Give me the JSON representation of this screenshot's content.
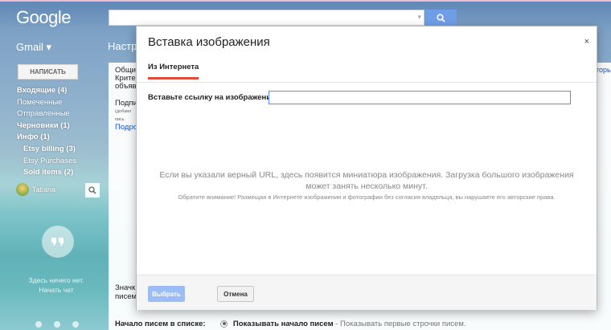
{
  "brand": {
    "logo": "Google"
  },
  "header": {
    "app_label": "Gmail ▾",
    "page_title_partial": "Настр"
  },
  "compose": {
    "label": "НАПИСАТЬ"
  },
  "sidebar": {
    "items": [
      {
        "label": "Входящие (4)"
      },
      {
        "label": "Помеченные"
      },
      {
        "label": "Отправленные"
      },
      {
        "label": "Черновики (1)"
      },
      {
        "label": "Инфо (1)"
      },
      {
        "label": "Etsy billing (3)"
      },
      {
        "label": "Etsy Purchases"
      },
      {
        "label": "Sold items (2)"
      }
    ],
    "user_name": "Tatiana"
  },
  "hangouts": {
    "line1": "Здесь ничего нет.",
    "line2": "Начать чат"
  },
  "settings": {
    "tab_partial": "Общие",
    "crit_partial1": "Критер",
    "crit_partial2": "объяв",
    "sig_partial": "Подпи",
    "sig_small1": "(добавл",
    "sig_small2": "пись",
    "sig_link": "Подроб",
    "start_partial1": "Значк",
    "start_partial2": "писем",
    "right_link_partial": "торы",
    "footer_label": "Начало писем в списке:",
    "footer_option": "Показывать начало писем",
    "footer_desc": " - Показывать первые строчки писем."
  },
  "dialog": {
    "title": "Вставка изображения",
    "close": "×",
    "tab": "Из Интернета",
    "url_label": "Вставьте ссылку на изображение:",
    "url_value": "",
    "message": "Если вы указали верный URL, здесь появится миниатюра изображения. Загрузка большого изображения может занять несколько минут.",
    "note": "Обратите внимание! Размещая в Интернете изображения и фотографии без согласия владельца, вы нарушаете его авторские права.",
    "select_label": "Выбрать",
    "cancel_label": "Отмена"
  },
  "colors": {
    "accent": "#4d90fe",
    "search_button": "#6f9ee9",
    "tab_underline": "#dd4b39",
    "disabled_button": "#9bbcf5"
  }
}
